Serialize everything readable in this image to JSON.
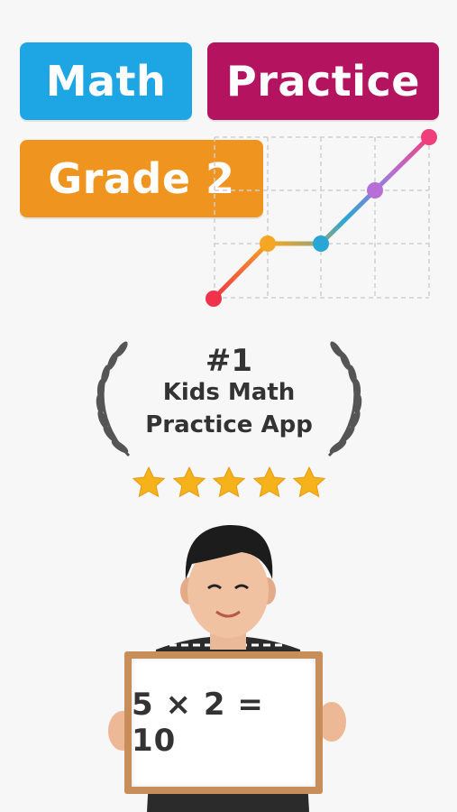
{
  "title": {
    "math": "Math",
    "practice": "Practice",
    "grade": "Grade 2"
  },
  "colors": {
    "math_pill": "#1ea6e4",
    "practice_pill": "#b3135f",
    "grade_pill": "#f09420"
  },
  "award": {
    "rank": "#1",
    "line1": "Kids Math",
    "line2": "Practice App",
    "stars": 5
  },
  "board": {
    "equation": "5 × 2 = 10"
  }
}
